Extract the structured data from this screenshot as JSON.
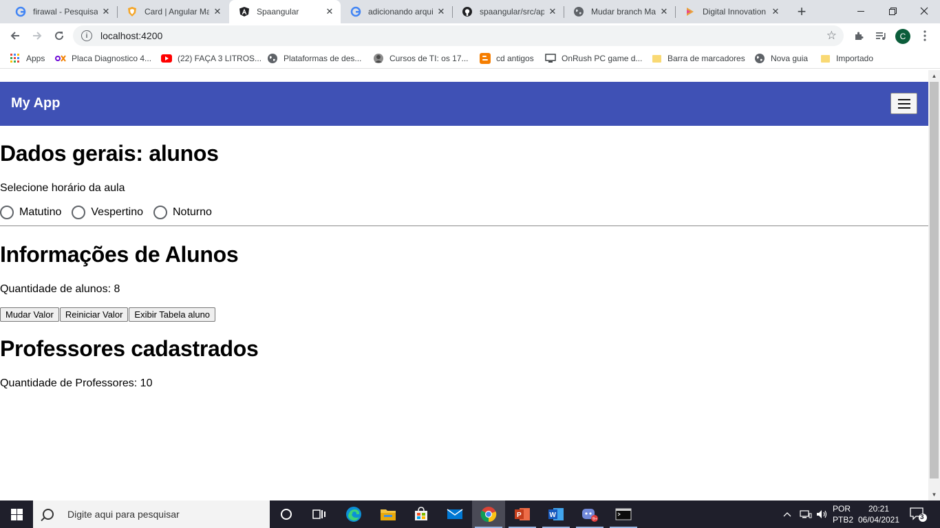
{
  "browser": {
    "tabs": [
      {
        "title": "firawal - Pesquisa Google",
        "icon": "google-icon"
      },
      {
        "title": "Card | Angular Material",
        "icon": "shield-icon"
      },
      {
        "title": "Spaangular",
        "icon": "angular-icon",
        "active": true
      },
      {
        "title": "adicionando arquivos",
        "icon": "google-icon"
      },
      {
        "title": "spaangular/src/app",
        "icon": "github-icon"
      },
      {
        "title": "Mudar branch Master",
        "icon": "globe-icon"
      },
      {
        "title": "Digital Innovation One",
        "icon": "dio-icon"
      }
    ],
    "address": "localhost:4200",
    "profile_initial": "C",
    "bookmarks": [
      {
        "label": "Apps",
        "icon": "apps-grid-icon"
      },
      {
        "label": "Placa Diagnostico 4...",
        "icon": "olx-icon"
      },
      {
        "label": "(22) FAÇA 3 LITROS...",
        "icon": "youtube-icon"
      },
      {
        "label": "Plataformas de des...",
        "icon": "globe-icon"
      },
      {
        "label": "Cursos de TI: os 17...",
        "icon": "avatar-icon"
      },
      {
        "label": "cd antigos",
        "icon": "blogger-icon"
      },
      {
        "label": "OnRush PC game d...",
        "icon": "monitor-icon"
      },
      {
        "label": "Barra de marcadores",
        "icon": "folder-icon"
      },
      {
        "label": "Nova guia",
        "icon": "globe-icon"
      },
      {
        "label": "Importado",
        "icon": "folder-icon"
      }
    ]
  },
  "app": {
    "title": "My App",
    "header_color": "#3f51b5",
    "dados_heading": "Dados gerais: alunos",
    "horario_label": "Selecione horário da aula",
    "radio_options": [
      "Matutino",
      "Vespertino",
      "Noturno"
    ],
    "info_heading": "Informações de Alunos",
    "qtd_alunos": "Quantidade de alunos: 8",
    "buttons": [
      "Mudar Valor",
      "Reiniciar Valor",
      "Exibir Tabela aluno"
    ],
    "prof_heading": "Professores cadastrados",
    "qtd_prof": "Quantidade de Professores: 10"
  },
  "taskbar": {
    "search_placeholder": "Digite aqui para pesquisar",
    "lang_top": "POR",
    "lang_bottom": "PTB2",
    "time": "20:21",
    "date": "06/04/2021",
    "notification_count": "3",
    "apps": [
      "cortana-icon",
      "task-view-icon",
      "edge-icon",
      "file-explorer-icon",
      "store-icon",
      "mail-icon",
      "chrome-icon",
      "powerpoint-icon",
      "word-icon",
      "discord-icon",
      "terminal-icon"
    ]
  }
}
